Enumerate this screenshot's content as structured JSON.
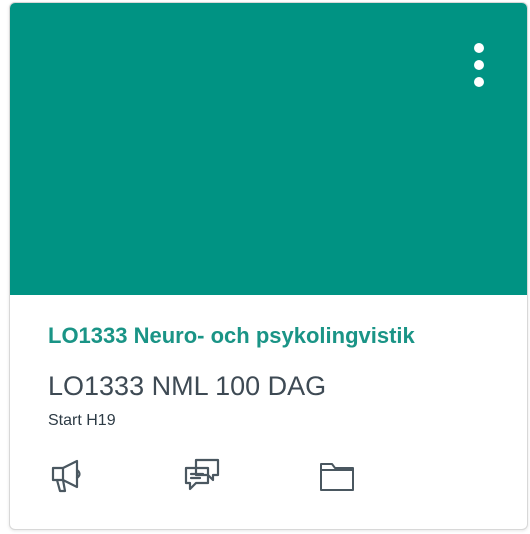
{
  "card": {
    "hero_color": "#009383",
    "title_color": "#1a9486",
    "title": "LO1333 Neuro- och psykolingvistik",
    "code": "LO1333 NML 100 DAG",
    "term": "Start H19",
    "menu_icon": "kebab-menu-icon",
    "actions": [
      {
        "icon": "announcements-megaphone-icon"
      },
      {
        "icon": "discussions-chat-icon"
      },
      {
        "icon": "files-folder-icon"
      }
    ]
  }
}
